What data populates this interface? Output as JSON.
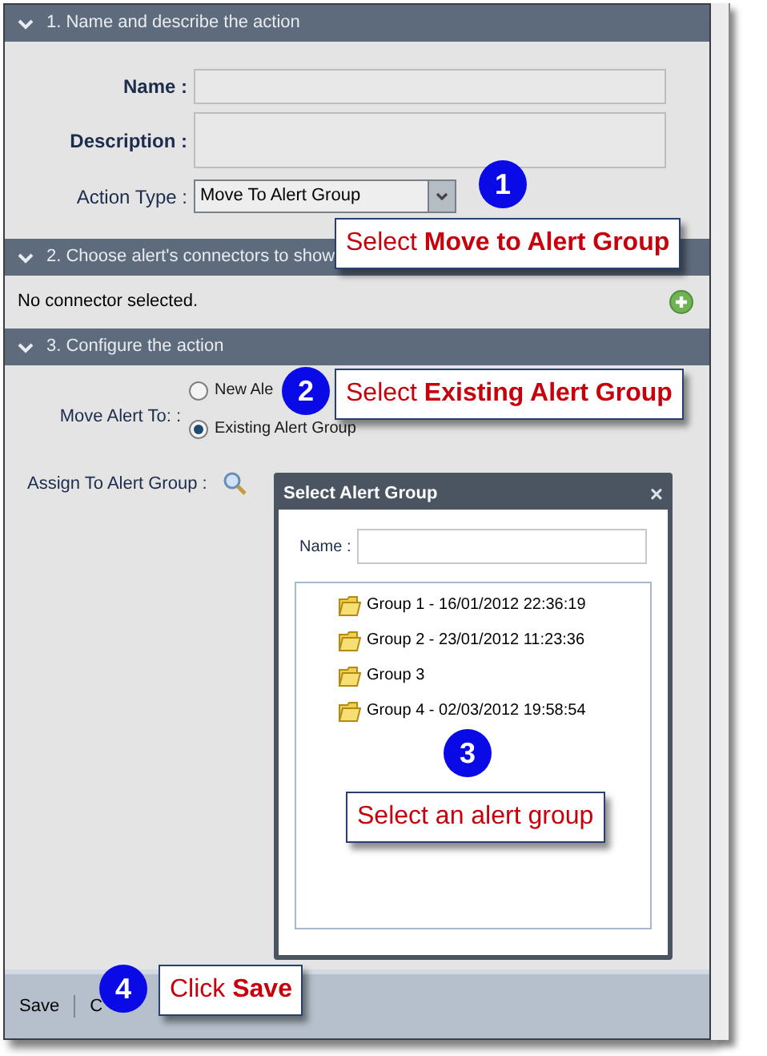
{
  "sections": [
    {
      "title": "1. Name and describe the action",
      "expanded": true
    },
    {
      "title": "2. Choose alert's connectors to show",
      "expanded": true
    },
    {
      "title": "3. Configure the action",
      "expanded": true
    }
  ],
  "form": {
    "name_label": "Name :",
    "description_label": "Description :",
    "action_type_label": "Action Type :",
    "action_type_value": "Move To Alert Group"
  },
  "connectors": {
    "empty_text": "No connector selected."
  },
  "configure": {
    "move_label": "Move Alert To:  :",
    "options": [
      {
        "label": "New Ale",
        "selected": false
      },
      {
        "label": "Existing Alert Group",
        "selected": true
      }
    ],
    "assign_label": "Assign To Alert Group :"
  },
  "dialog": {
    "title": "Select Alert Group",
    "close": "×",
    "name_label": "Name :",
    "groups": [
      "Group 1 - 16/01/2012 22:36:19",
      "Group 2 - 23/01/2012 11:23:36",
      "Group 3",
      "Group 4 - 02/03/2012 19:58:54"
    ]
  },
  "footer": {
    "buttons": [
      "Save",
      "C"
    ]
  },
  "callouts": [
    {
      "number": "1",
      "text": "Select **Move to Alert Group**"
    },
    {
      "number": "2",
      "text": "Select **Existing Alert Group**"
    },
    {
      "number": "3",
      "text": "Select an alert group"
    },
    {
      "number": "4",
      "text": "Click **Save**"
    }
  ]
}
